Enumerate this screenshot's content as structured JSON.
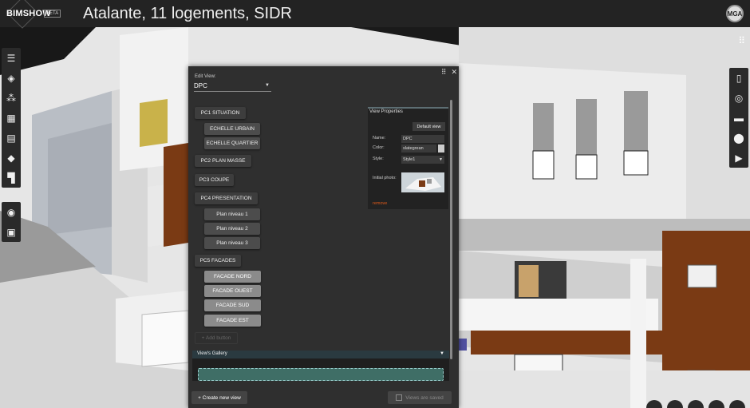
{
  "app": {
    "name": "BIMSHOW",
    "badge": "BETA",
    "project_title": "Atalante, 11 logements, SIDR",
    "user_initials": "MGA"
  },
  "left_toolbar": [
    {
      "icon": "list-icon"
    },
    {
      "icon": "layers-icon"
    },
    {
      "icon": "cubes-icon"
    },
    {
      "icon": "calendar-icon"
    },
    {
      "icon": "chart-icon"
    },
    {
      "icon": "tag-icon"
    },
    {
      "icon": "paint-roller-icon"
    }
  ],
  "left_toolbar_2": [
    {
      "icon": "camera-icon"
    },
    {
      "icon": "image-icon"
    }
  ],
  "right_toolbar": [
    {
      "icon": "document-icon"
    },
    {
      "icon": "eye-icon"
    },
    {
      "icon": "ruler-icon"
    },
    {
      "icon": "location-pin-icon"
    },
    {
      "icon": "play-circle-icon"
    }
  ],
  "panel": {
    "edit_view_label": "Edit View:",
    "selected_view": "DPC",
    "buttons": {
      "pc1": "PC1 SITUATION",
      "echelle_urbain": "ECHELLE URBAIN",
      "echelle_quartier": "ECHELLE QUARTIER",
      "pc2": "PC2 PLAN MASSE",
      "pc3": "PC3 COUPE",
      "pc4": "PC4 PRESENTATION",
      "plan1": "Plan niveau 1",
      "plan2": "Plan niveau 2",
      "plan3": "Plan niveau 3",
      "pc5": "PC5 FACADES",
      "facade_nord": "FACADE NORD",
      "facade_ouest": "FACADE OUEST",
      "facade_sud": "FACADE SUD",
      "facade_est": "FACADE EST",
      "add_button": "+ Add button"
    },
    "view_properties": {
      "title": "View Properties",
      "default_view": "Default view",
      "name_label": "Name:",
      "name_value": "DPC",
      "color_label": "Color:",
      "color_value": "slategrean",
      "style_label": "Style:",
      "style_value": "Style1",
      "photo_label": "Initial photo:",
      "remove": "remove"
    },
    "gallery_title": "View's Gallery",
    "create_new_view": "+ Create new view",
    "views_saved": "Views are saved"
  },
  "colors": {
    "header": "#232323",
    "panel": "#2f2f2f",
    "gallery_drop": "#3f6e66",
    "remove": "#e05a1a",
    "brick": "#7a3a14"
  }
}
